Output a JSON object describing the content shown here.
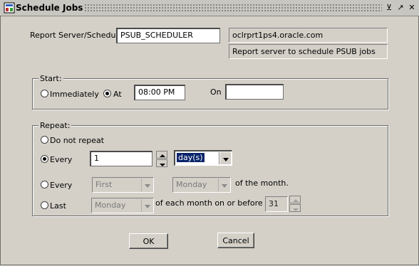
{
  "window": {
    "title": "Schedule Jobs",
    "minimize_glyph": "⊻",
    "maximize_glyph": "↗",
    "close_glyph": "✕"
  },
  "report_server": {
    "label": "Report Server/Scheduler",
    "value": "PSUB_SCHEDULER",
    "host": "oclrprt1ps4.oracle.com",
    "description": "Report server to schedule PSUB jobs"
  },
  "start": {
    "title": "Start:",
    "immediately_label": "Immediately",
    "at_label": "At",
    "at_value": "08:00 PM",
    "on_label": "On",
    "on_value": "",
    "selected": "at"
  },
  "repeat": {
    "title": "Repeat:",
    "do_not_repeat_label": "Do not repeat",
    "every_label": "Every",
    "every_value": "1",
    "every_unit": "day(s)",
    "every2_label": "Every",
    "ordinal": "First",
    "weekday": "Monday",
    "of_month_label": "of the month.",
    "last_label": "Last",
    "last_weekday": "Monday",
    "each_month_label": "of each month on or before day",
    "day_value": "31",
    "selected": "every"
  },
  "buttons": {
    "ok": "OK",
    "cancel": "Cancel"
  }
}
